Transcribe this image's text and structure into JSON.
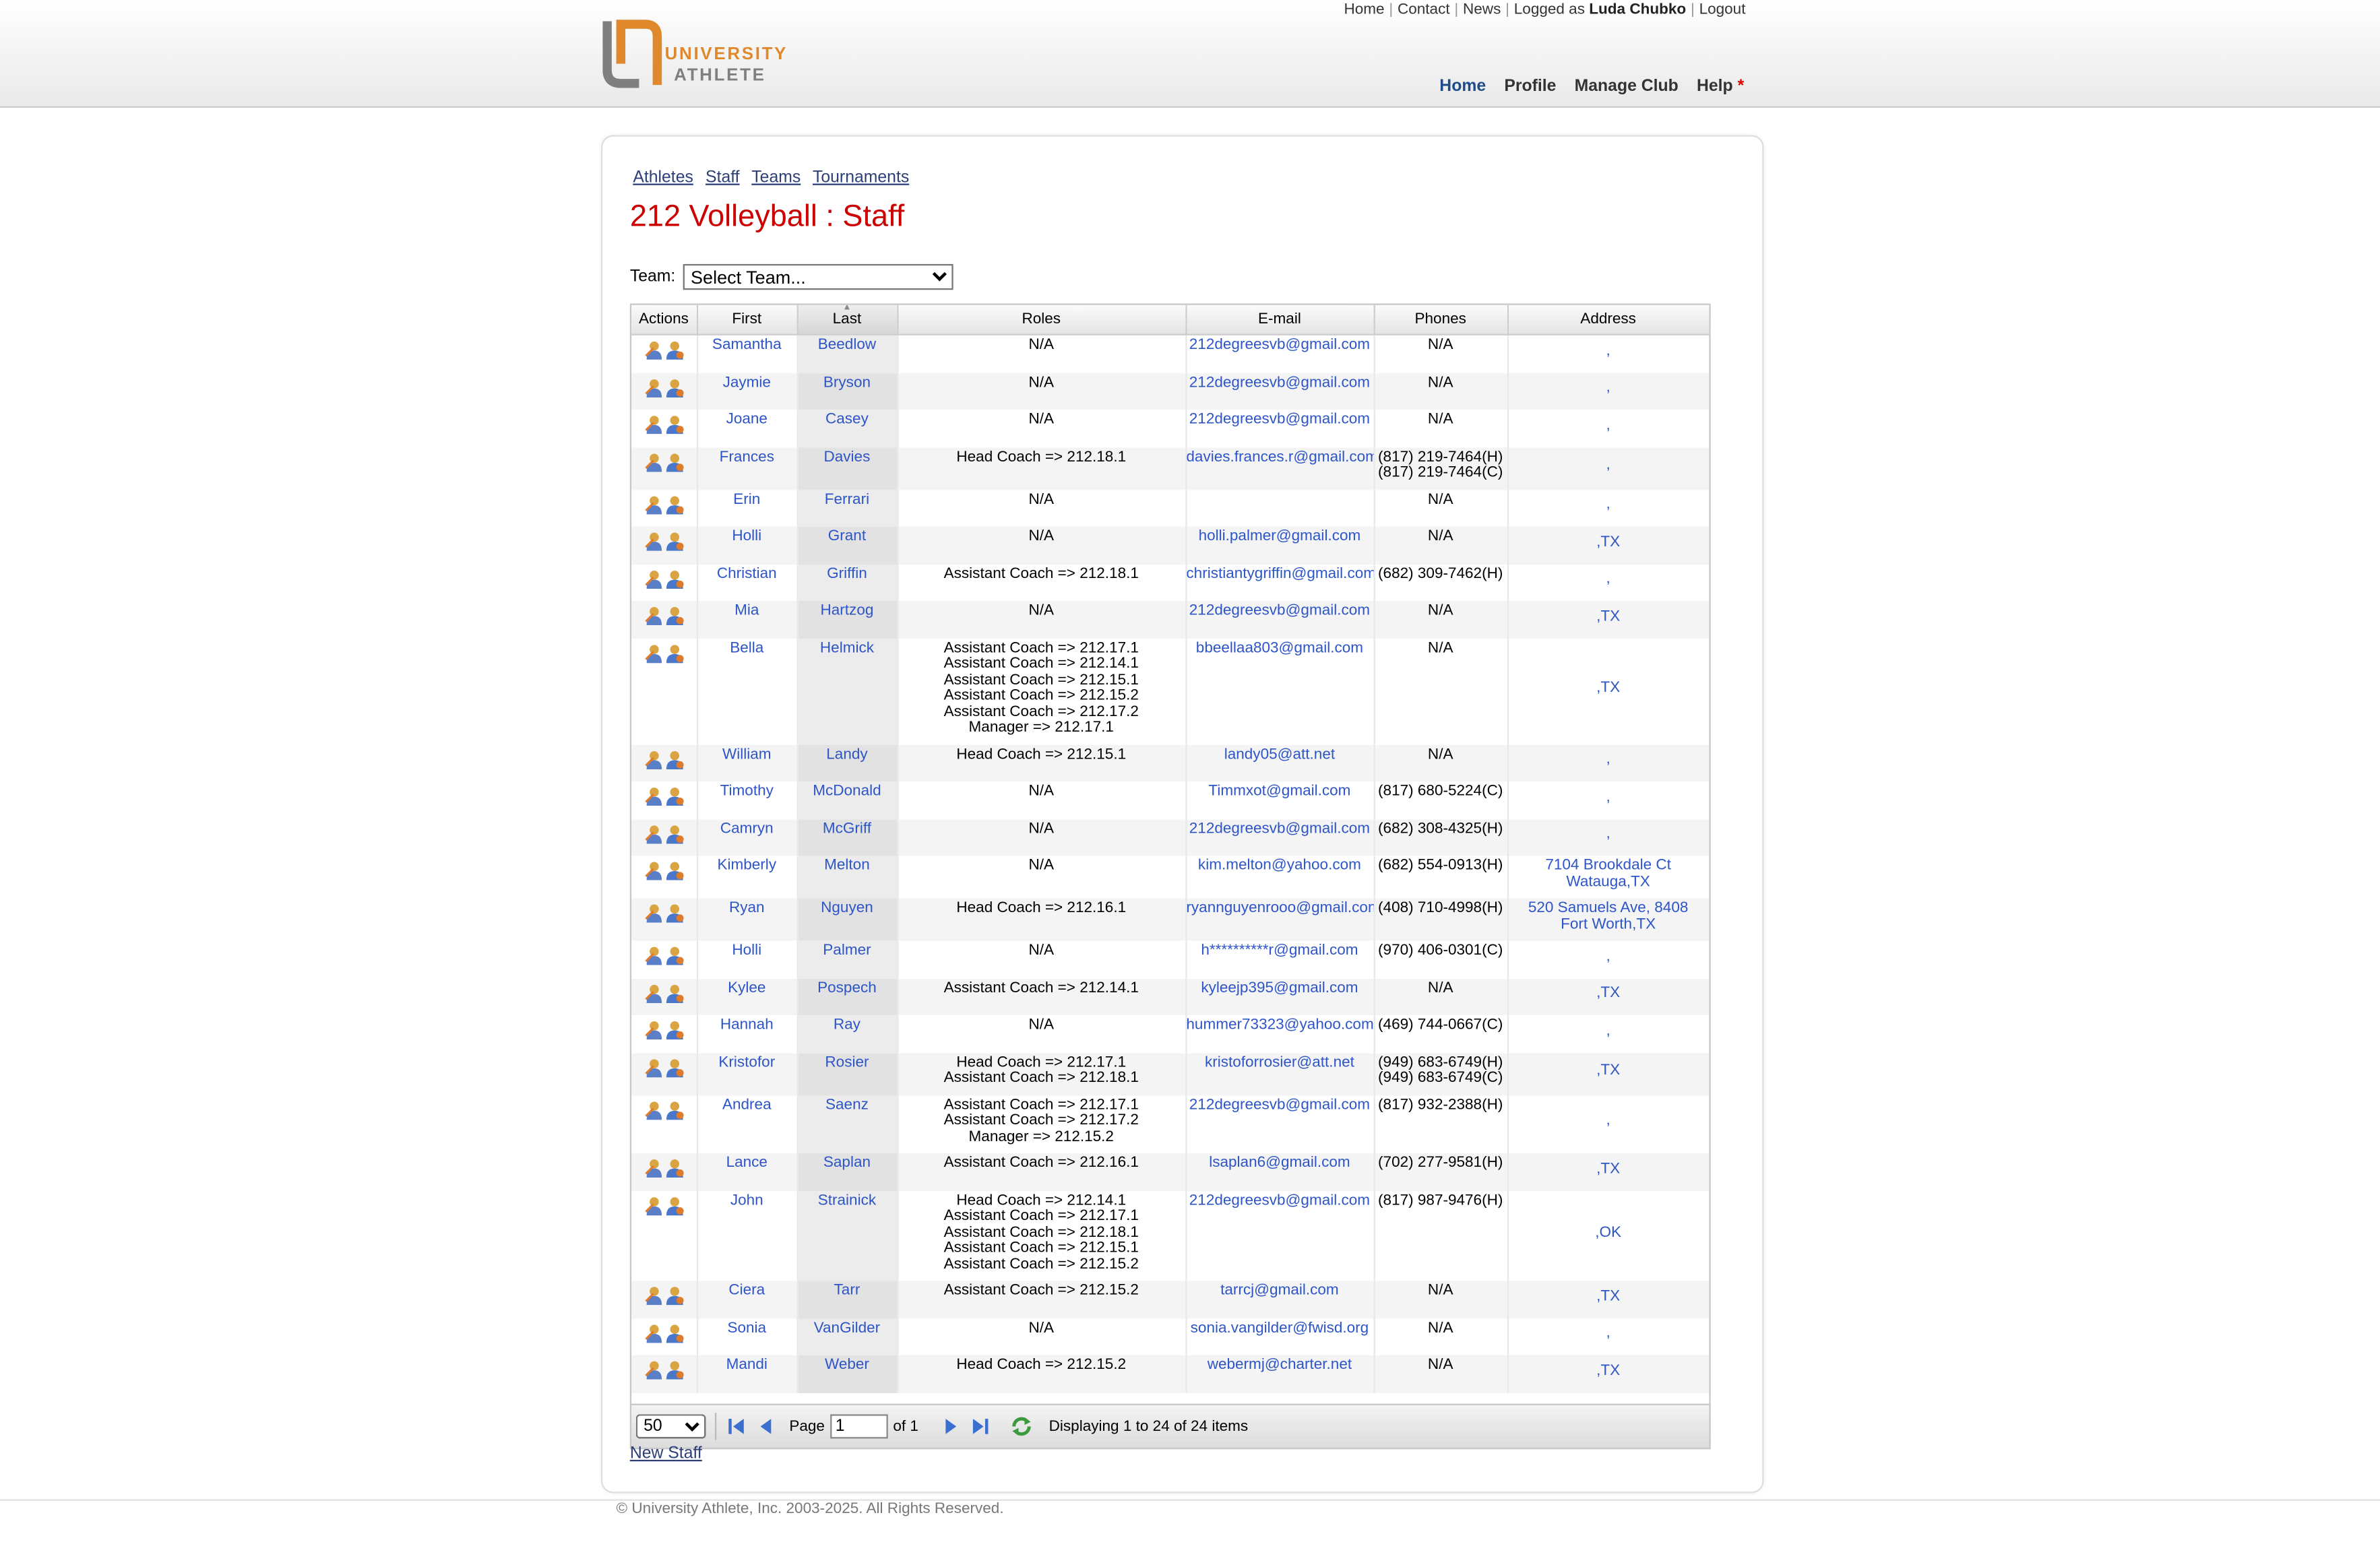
{
  "top_links": {
    "home": "Home",
    "contact": "Contact",
    "news": "News",
    "logged_as": "Logged as",
    "user": "Luda Chubko",
    "logout": "Logout"
  },
  "logo": {
    "line1": "UNIVERSITY",
    "line2": "ATHLETE",
    "accent": "#e0892c",
    "gray": "#7f7f7f"
  },
  "main_nav": {
    "home": "Home",
    "profile": "Profile",
    "manage_club": "Manage Club",
    "help": "Help",
    "help_marker": "*"
  },
  "subnav": [
    "Athletes",
    "Staff",
    "Teams",
    "Tournaments"
  ],
  "page_title": "212 Volleyball : Staff",
  "team_filter": {
    "label": "Team:",
    "selected": "Select Team..."
  },
  "grid": {
    "columns": [
      "Actions",
      "First",
      "Last",
      "Roles",
      "E-mail",
      "Phones",
      "Address"
    ],
    "rows": [
      {
        "first": "Samantha",
        "last": "Beedlow",
        "roles": [
          "N/A"
        ],
        "email": "212degreesvb@gmail.com",
        "phones": [
          "N/A"
        ],
        "address": [
          ","
        ]
      },
      {
        "first": "Jaymie",
        "last": "Bryson",
        "roles": [
          "N/A"
        ],
        "email": "212degreesvb@gmail.com",
        "phones": [
          "N/A"
        ],
        "address": [
          ","
        ]
      },
      {
        "first": "Joane",
        "last": "Casey",
        "roles": [
          "N/A"
        ],
        "email": "212degreesvb@gmail.com",
        "phones": [
          "N/A"
        ],
        "address": [
          ","
        ]
      },
      {
        "first": "Frances",
        "last": "Davies",
        "roles": [
          "Head Coach => 212.18.1"
        ],
        "email": "davies.frances.r@gmail.com",
        "phones": [
          "(817) 219-7464(H)",
          "(817) 219-7464(C)"
        ],
        "address": [
          ","
        ]
      },
      {
        "first": "Erin",
        "last": "Ferrari",
        "roles": [
          "N/A"
        ],
        "email": "",
        "phones": [
          "N/A"
        ],
        "address": [
          ","
        ]
      },
      {
        "first": "Holli",
        "last": "Grant",
        "roles": [
          "N/A"
        ],
        "email": "holli.palmer@gmail.com",
        "phones": [
          "N/A"
        ],
        "address": [
          ",TX"
        ]
      },
      {
        "first": "Christian",
        "last": "Griffin",
        "roles": [
          "Assistant Coach => 212.18.1"
        ],
        "email": "christiantygriffin@gmail.com",
        "phones": [
          "(682) 309-7462(H)"
        ],
        "address": [
          ","
        ]
      },
      {
        "first": "Mia",
        "last": "Hartzog",
        "roles": [
          "N/A"
        ],
        "email": "212degreesvb@gmail.com",
        "phones": [
          "N/A"
        ],
        "address": [
          ",TX"
        ]
      },
      {
        "first": "Bella",
        "last": "Helmick",
        "roles": [
          "Assistant Coach => 212.17.1",
          "Assistant Coach => 212.14.1",
          "Assistant Coach => 212.15.1",
          "Assistant Coach => 212.15.2",
          "Assistant Coach => 212.17.2",
          "Manager => 212.17.1"
        ],
        "email": "bbeellaa803@gmail.com",
        "phones": [
          "N/A"
        ],
        "address": [
          ",TX"
        ]
      },
      {
        "first": "William",
        "last": "Landy",
        "roles": [
          "Head Coach => 212.15.1"
        ],
        "email": "landy05@att.net",
        "phones": [
          "N/A"
        ],
        "address": [
          ","
        ]
      },
      {
        "first": "Timothy",
        "last": "McDonald",
        "roles": [
          "N/A"
        ],
        "email": "Timmxot@gmail.com",
        "phones": [
          "(817) 680-5224(C)"
        ],
        "address": [
          ","
        ]
      },
      {
        "first": "Camryn",
        "last": "McGriff",
        "roles": [
          "N/A"
        ],
        "email": "212degreesvb@gmail.com",
        "phones": [
          "(682) 308-4325(H)"
        ],
        "address": [
          ","
        ]
      },
      {
        "first": "Kimberly",
        "last": "Melton",
        "roles": [
          "N/A"
        ],
        "email": "kim.melton@yahoo.com",
        "phones": [
          "(682) 554-0913(H)"
        ],
        "address": [
          "7104 Brookdale Ct",
          "Watauga,TX"
        ]
      },
      {
        "first": "Ryan",
        "last": "Nguyen",
        "roles": [
          "Head Coach => 212.16.1"
        ],
        "email": "ryannguyenrooo@gmail.com",
        "phones": [
          "(408) 710-4998(H)"
        ],
        "address": [
          "520 Samuels Ave, 8408",
          "Fort Worth,TX"
        ]
      },
      {
        "first": "Holli",
        "last": "Palmer",
        "roles": [
          "N/A"
        ],
        "email": "h**********r@gmail.com",
        "phones": [
          "(970) 406-0301(C)"
        ],
        "address": [
          ","
        ]
      },
      {
        "first": "Kylee",
        "last": "Pospech",
        "roles": [
          "Assistant Coach => 212.14.1"
        ],
        "email": "kyleejp395@gmail.com",
        "phones": [
          "N/A"
        ],
        "address": [
          ",TX"
        ]
      },
      {
        "first": "Hannah",
        "last": "Ray",
        "roles": [
          "N/A"
        ],
        "email": "hummer73323@yahoo.com",
        "phones": [
          "(469) 744-0667(C)"
        ],
        "address": [
          ","
        ]
      },
      {
        "first": "Kristofor",
        "last": "Rosier",
        "roles": [
          "Head Coach => 212.17.1",
          "Assistant Coach => 212.18.1"
        ],
        "email": "kristoforrosier@att.net",
        "phones": [
          "(949) 683-6749(H)",
          "(949) 683-6749(C)"
        ],
        "address": [
          ",TX"
        ]
      },
      {
        "first": "Andrea",
        "last": "Saenz",
        "roles": [
          "Assistant Coach => 212.17.1",
          "Assistant Coach => 212.17.2",
          "Manager => 212.15.2"
        ],
        "email": "212degreesvb@gmail.com",
        "phones": [
          "(817) 932-2388(H)"
        ],
        "address": [
          ","
        ]
      },
      {
        "first": "Lance",
        "last": "Saplan",
        "roles": [
          "Assistant Coach => 212.16.1"
        ],
        "email": "lsaplan6@gmail.com",
        "phones": [
          "(702) 277-9581(H)"
        ],
        "address": [
          ",TX"
        ]
      },
      {
        "first": "John",
        "last": "Strainick",
        "roles": [
          "Head Coach => 212.14.1",
          "Assistant Coach => 212.17.1",
          "Assistant Coach => 212.18.1",
          "Assistant Coach => 212.15.1",
          "Assistant Coach => 212.15.2"
        ],
        "email": "212degreesvb@gmail.com",
        "phones": [
          "(817) 987-9476(H)"
        ],
        "address": [
          ",OK"
        ]
      },
      {
        "first": "Ciera",
        "last": "Tarr",
        "roles": [
          "Assistant Coach => 212.15.2"
        ],
        "email": "tarrcj@gmail.com",
        "phones": [
          "N/A"
        ],
        "address": [
          ",TX"
        ]
      },
      {
        "first": "Sonia",
        "last": "VanGilder",
        "roles": [
          "N/A"
        ],
        "email": "sonia.vangilder@fwisd.org",
        "phones": [
          "N/A"
        ],
        "address": [
          ","
        ]
      },
      {
        "first": "Mandi",
        "last": "Weber",
        "roles": [
          "Head Coach => 212.15.2"
        ],
        "email": "webermj@charter.net",
        "phones": [
          "N/A"
        ],
        "address": [
          ",TX"
        ]
      }
    ]
  },
  "pager": {
    "page_size": "50",
    "page_label": "Page",
    "page_value": "1",
    "of_label": "of 1",
    "displaying": "Displaying 1 to 24 of 24 items"
  },
  "new_staff": "New Staff",
  "copyright": "© University Athlete, Inc. 2003-2025. All Rights Reserved.",
  "colors": {
    "link": "#2d55c8",
    "title": "#cc0000",
    "nav_active": "#1e4b8a"
  }
}
